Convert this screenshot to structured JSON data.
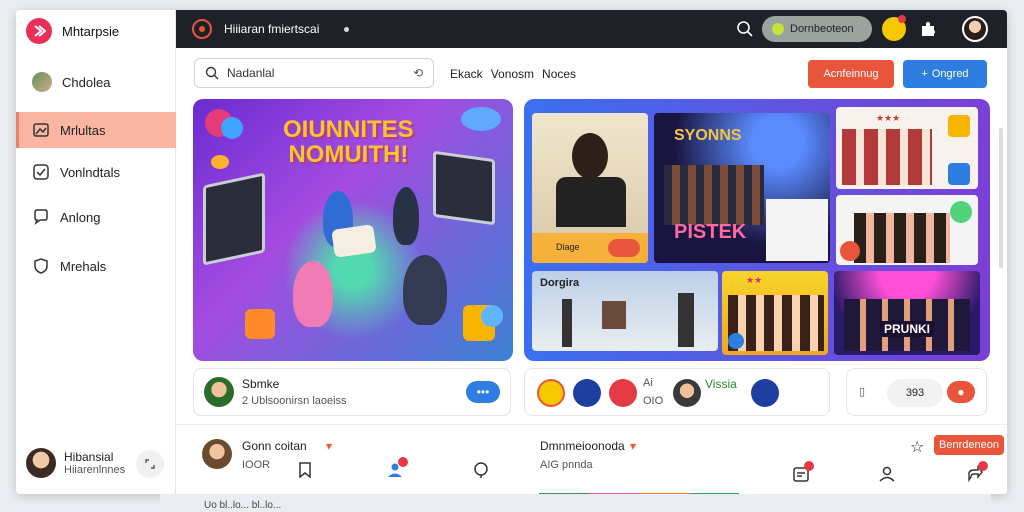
{
  "sidebar": {
    "brand": "Mhtarpsie",
    "items": [
      {
        "label": "Chdolea"
      },
      {
        "label": "Mrlultas"
      },
      {
        "label": "Vonlndtals"
      },
      {
        "label": "Anlong"
      },
      {
        "label": "Mrehals"
      }
    ],
    "user": {
      "name": "Hibansial",
      "handle": "Hiiarenlnnes"
    }
  },
  "topbar": {
    "title": "Hiiiaran fmiertscai",
    "pill": "Dornbeoteon"
  },
  "toolbar": {
    "search_value": "Nadanlal",
    "filters": [
      "Ekack",
      "Vonosm",
      "Noces"
    ],
    "primary_button": "Acnfeinnug",
    "secondary_button": "Ongred"
  },
  "hero": {
    "title_line1": "OIUNNITES",
    "title_line2": "NOMUITH!"
  },
  "gallery": {
    "labels": [
      "SYONNS",
      "PISTEK",
      "Dorgira",
      "PRUNKI"
    ],
    "button": "Diage"
  },
  "info": {
    "name": "Sbmke",
    "sub": "2 Ublsoonirsn laoeiss",
    "mid_label1": "Ai",
    "mid_label2": "OIO",
    "mid_tag": "Vissia",
    "right_value": "393"
  },
  "bottom": {
    "left_name": "Gonn coitan",
    "left_sub": "IOOR",
    "right_title": "Dmnmeioonoda",
    "right_sub": "AIG  pnnda",
    "right_button": "Benrdeneon"
  },
  "under": {
    "text": "Uo bl..lo... bl..lo..."
  },
  "colors": {
    "accent_red": "#e8553a",
    "accent_blue": "#2e7de0",
    "sidebar_active": "#fbb6a3",
    "topbar_bg": "#1e2128"
  }
}
